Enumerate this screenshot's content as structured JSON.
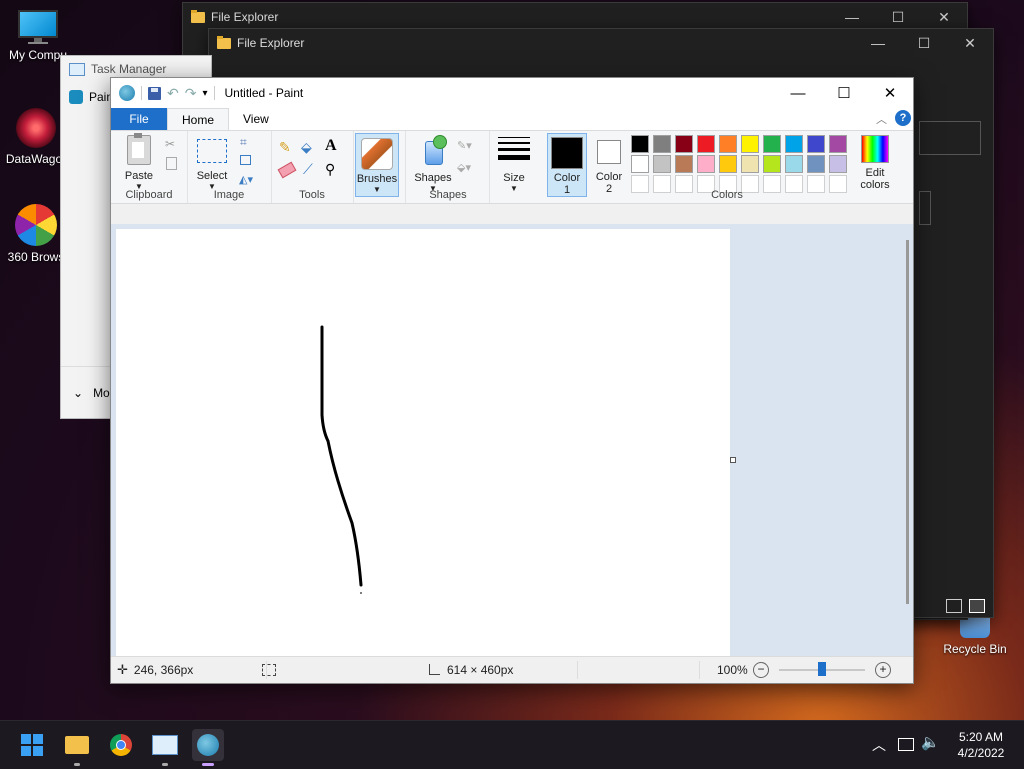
{
  "desktop": {
    "icons": [
      {
        "label": "My Compu",
        "icon": "monitor-icon"
      },
      {
        "label": "DataWagor",
        "icon": "datawagon-icon"
      },
      {
        "label": "360 Brows",
        "icon": "browser-360-icon"
      },
      {
        "label": "Recycle Bin",
        "icon": "recycle-bin-icon"
      }
    ]
  },
  "explorer_windows": [
    {
      "title": "File Explorer"
    },
    {
      "title": "File Explorer"
    }
  ],
  "task_manager": {
    "title": "Task Manager",
    "item": "Pain",
    "more": "Mo"
  },
  "paint": {
    "title": "Untitled - Paint",
    "tabs": {
      "file": "File",
      "home": "Home",
      "view": "View"
    },
    "ribbon": {
      "clipboard": {
        "label": "Clipboard",
        "paste": "Paste"
      },
      "image": {
        "label": "Image",
        "select": "Select"
      },
      "tools": {
        "label": "Tools"
      },
      "brushes": "Brushes",
      "shapes": {
        "label": "Shapes",
        "button": "Shapes"
      },
      "size": "Size",
      "color1": "Color",
      "color1_num": "1",
      "color2": "Color",
      "color2_num": "2",
      "colors_label": "Colors",
      "edit_colors_1": "Edit",
      "edit_colors_2": "colors"
    },
    "palette_row1": [
      "#000000",
      "#7f7f7f",
      "#880015",
      "#ed1c24",
      "#ff7f27",
      "#fff200",
      "#22b14c",
      "#00a2e8",
      "#3f48cc",
      "#a349a4"
    ],
    "palette_row2": [
      "#ffffff",
      "#c3c3c3",
      "#b97a57",
      "#ffaec9",
      "#ffc90e",
      "#efe4b0",
      "#b5e61d",
      "#99d9ea",
      "#7092be",
      "#c8bfe7"
    ],
    "color1_value": "#000000",
    "color2_value": "#ffffff",
    "status": {
      "cursor_pos": "246, 366px",
      "canvas_size": "614 × 460px",
      "zoom": "100%",
      "zoom_fraction": 0.5
    }
  },
  "taskbar": {
    "time": "5:20 AM",
    "date": "4/2/2022"
  }
}
